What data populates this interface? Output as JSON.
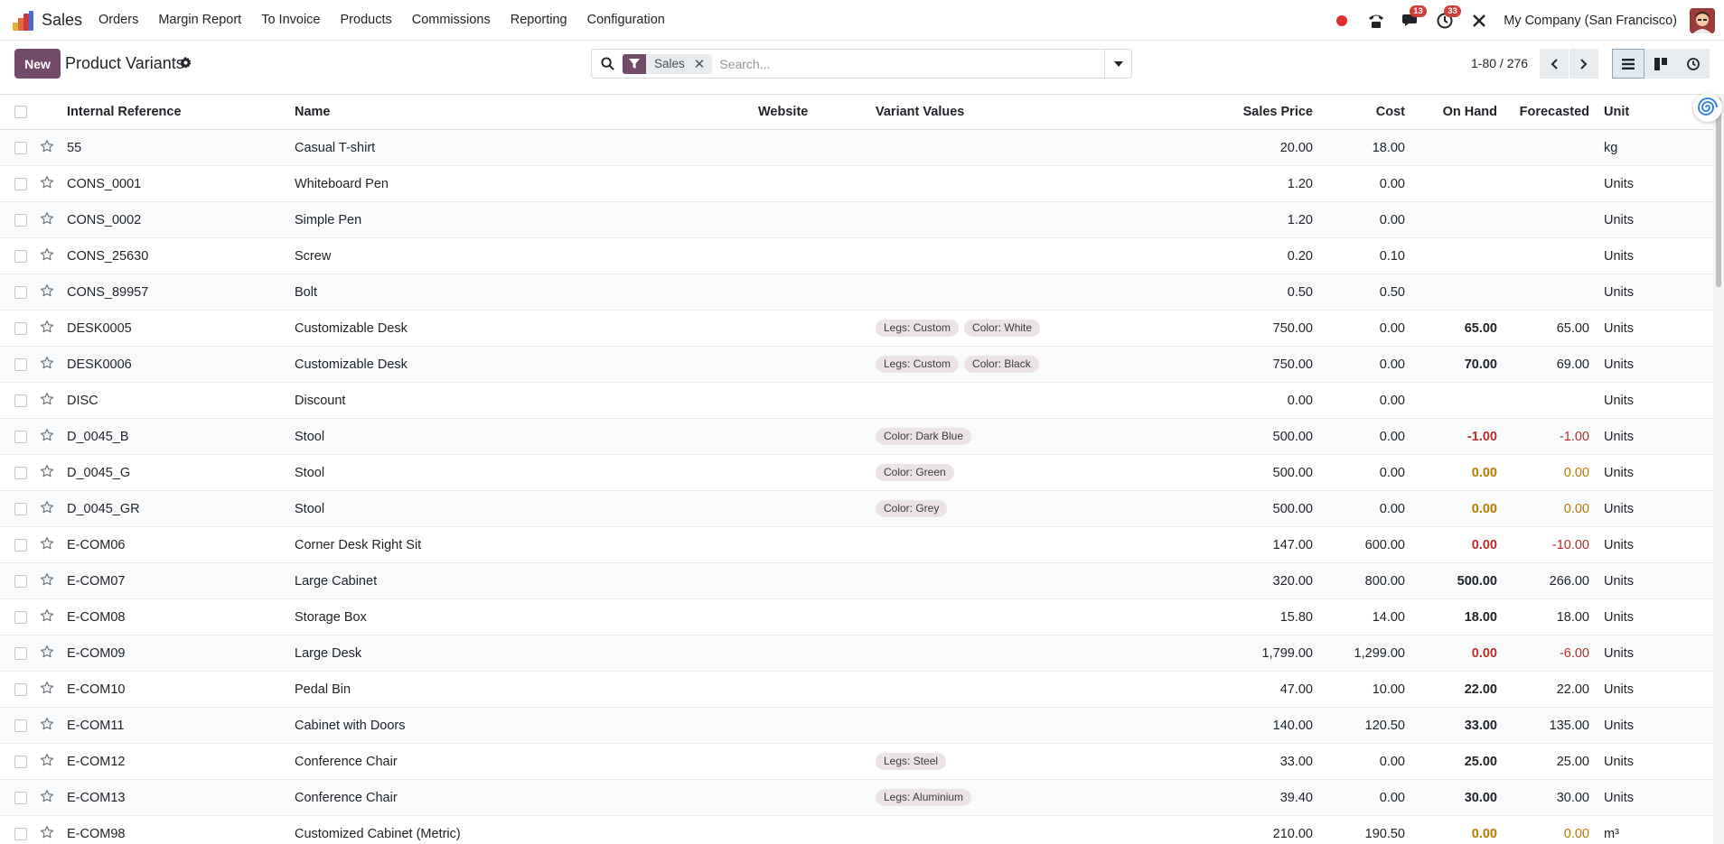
{
  "app": {
    "name": "Sales",
    "logo_colors": [
      "#e8b23a",
      "#e16a3c",
      "#c83a3f",
      "#4a6ad4"
    ]
  },
  "menu": [
    "Orders",
    "Margin Report",
    "To Invoice",
    "Products",
    "Commissions",
    "Reporting",
    "Configuration"
  ],
  "systray": {
    "recording_color": "#e02d2d",
    "messages_badge": "13",
    "activities_badge": "33",
    "company": "My Company (San Francisco)"
  },
  "control_panel": {
    "new_label": "New",
    "title": "Product Variants",
    "search": {
      "facet_label": "Sales",
      "placeholder": "Search..."
    },
    "pager": "1-80 / 276"
  },
  "colors": {
    "primary": "#714b67",
    "negative": "#b5302b",
    "zero_warning": "#b87a00"
  },
  "table": {
    "columns": [
      "Internal Reference",
      "Name",
      "Website",
      "Variant Values",
      "Sales Price",
      "Cost",
      "On Hand",
      "Forecasted",
      "Unit"
    ],
    "rows": [
      {
        "ref": "55",
        "name": "Casual T-shirt",
        "tags": [],
        "price": "20.00",
        "cost": "18.00",
        "onhand": "",
        "onhand_style": "",
        "forecast": "",
        "forecast_style": "",
        "unit": "kg"
      },
      {
        "ref": "CONS_0001",
        "name": "Whiteboard Pen",
        "tags": [],
        "price": "1.20",
        "cost": "0.00",
        "onhand": "",
        "onhand_style": "",
        "forecast": "",
        "forecast_style": "",
        "unit": "Units"
      },
      {
        "ref": "CONS_0002",
        "name": "Simple Pen",
        "tags": [],
        "price": "1.20",
        "cost": "0.00",
        "onhand": "",
        "onhand_style": "",
        "forecast": "",
        "forecast_style": "",
        "unit": "Units"
      },
      {
        "ref": "CONS_25630",
        "name": "Screw",
        "tags": [],
        "price": "0.20",
        "cost": "0.10",
        "onhand": "",
        "onhand_style": "",
        "forecast": "",
        "forecast_style": "",
        "unit": "Units"
      },
      {
        "ref": "CONS_89957",
        "name": "Bolt",
        "tags": [],
        "price": "0.50",
        "cost": "0.50",
        "onhand": "",
        "onhand_style": "",
        "forecast": "",
        "forecast_style": "",
        "unit": "Units"
      },
      {
        "ref": "DESK0005",
        "name": "Customizable Desk",
        "tags": [
          "Legs: Custom",
          "Color: White"
        ],
        "price": "750.00",
        "cost": "0.00",
        "onhand": "65.00",
        "onhand_style": "bold",
        "forecast": "65.00",
        "forecast_style": "",
        "unit": "Units"
      },
      {
        "ref": "DESK0006",
        "name": "Customizable Desk",
        "tags": [
          "Legs: Custom",
          "Color: Black"
        ],
        "price": "750.00",
        "cost": "0.00",
        "onhand": "70.00",
        "onhand_style": "bold",
        "forecast": "69.00",
        "forecast_style": "",
        "unit": "Units"
      },
      {
        "ref": "DISC",
        "name": "Discount",
        "tags": [],
        "price": "0.00",
        "cost": "0.00",
        "onhand": "",
        "onhand_style": "",
        "forecast": "",
        "forecast_style": "",
        "unit": "Units"
      },
      {
        "ref": "D_0045_B",
        "name": "Stool",
        "tags": [
          "Color: Dark Blue"
        ],
        "price": "500.00",
        "cost": "0.00",
        "onhand": "-1.00",
        "onhand_style": "neg",
        "forecast": "-1.00",
        "forecast_style": "neg",
        "unit": "Units"
      },
      {
        "ref": "D_0045_G",
        "name": "Stool",
        "tags": [
          "Color: Green"
        ],
        "price": "500.00",
        "cost": "0.00",
        "onhand": "0.00",
        "onhand_style": "zero",
        "forecast": "0.00",
        "forecast_style": "zero",
        "unit": "Units"
      },
      {
        "ref": "D_0045_GR",
        "name": "Stool",
        "tags": [
          "Color: Grey"
        ],
        "price": "500.00",
        "cost": "0.00",
        "onhand": "0.00",
        "onhand_style": "zero",
        "forecast": "0.00",
        "forecast_style": "zero",
        "unit": "Units"
      },
      {
        "ref": "E-COM06",
        "name": "Corner Desk Right Sit",
        "tags": [],
        "price": "147.00",
        "cost": "600.00",
        "onhand": "0.00",
        "onhand_style": "neg",
        "forecast": "-10.00",
        "forecast_style": "neg",
        "unit": "Units"
      },
      {
        "ref": "E-COM07",
        "name": "Large Cabinet",
        "tags": [],
        "price": "320.00",
        "cost": "800.00",
        "onhand": "500.00",
        "onhand_style": "bold",
        "forecast": "266.00",
        "forecast_style": "",
        "unit": "Units"
      },
      {
        "ref": "E-COM08",
        "name": "Storage Box",
        "tags": [],
        "price": "15.80",
        "cost": "14.00",
        "onhand": "18.00",
        "onhand_style": "bold",
        "forecast": "18.00",
        "forecast_style": "",
        "unit": "Units"
      },
      {
        "ref": "E-COM09",
        "name": "Large Desk",
        "tags": [],
        "price": "1,799.00",
        "cost": "1,299.00",
        "onhand": "0.00",
        "onhand_style": "neg",
        "forecast": "-6.00",
        "forecast_style": "neg",
        "unit": "Units"
      },
      {
        "ref": "E-COM10",
        "name": "Pedal Bin",
        "tags": [],
        "price": "47.00",
        "cost": "10.00",
        "onhand": "22.00",
        "onhand_style": "bold",
        "forecast": "22.00",
        "forecast_style": "",
        "unit": "Units"
      },
      {
        "ref": "E-COM11",
        "name": "Cabinet with Doors",
        "tags": [],
        "price": "140.00",
        "cost": "120.50",
        "onhand": "33.00",
        "onhand_style": "bold",
        "forecast": "135.00",
        "forecast_style": "",
        "unit": "Units"
      },
      {
        "ref": "E-COM12",
        "name": "Conference Chair",
        "tags": [
          "Legs: Steel"
        ],
        "price": "33.00",
        "cost": "0.00",
        "onhand": "25.00",
        "onhand_style": "bold",
        "forecast": "25.00",
        "forecast_style": "",
        "unit": "Units"
      },
      {
        "ref": "E-COM13",
        "name": "Conference Chair",
        "tags": [
          "Legs: Aluminium"
        ],
        "price": "39.40",
        "cost": "0.00",
        "onhand": "30.00",
        "onhand_style": "bold",
        "forecast": "30.00",
        "forecast_style": "",
        "unit": "Units"
      },
      {
        "ref": "E-COM98",
        "name": "Customized Cabinet (Metric)",
        "tags": [],
        "price": "210.00",
        "cost": "190.50",
        "onhand": "0.00",
        "onhand_style": "zero",
        "forecast": "0.00",
        "forecast_style": "zero",
        "unit": "m³"
      }
    ]
  }
}
